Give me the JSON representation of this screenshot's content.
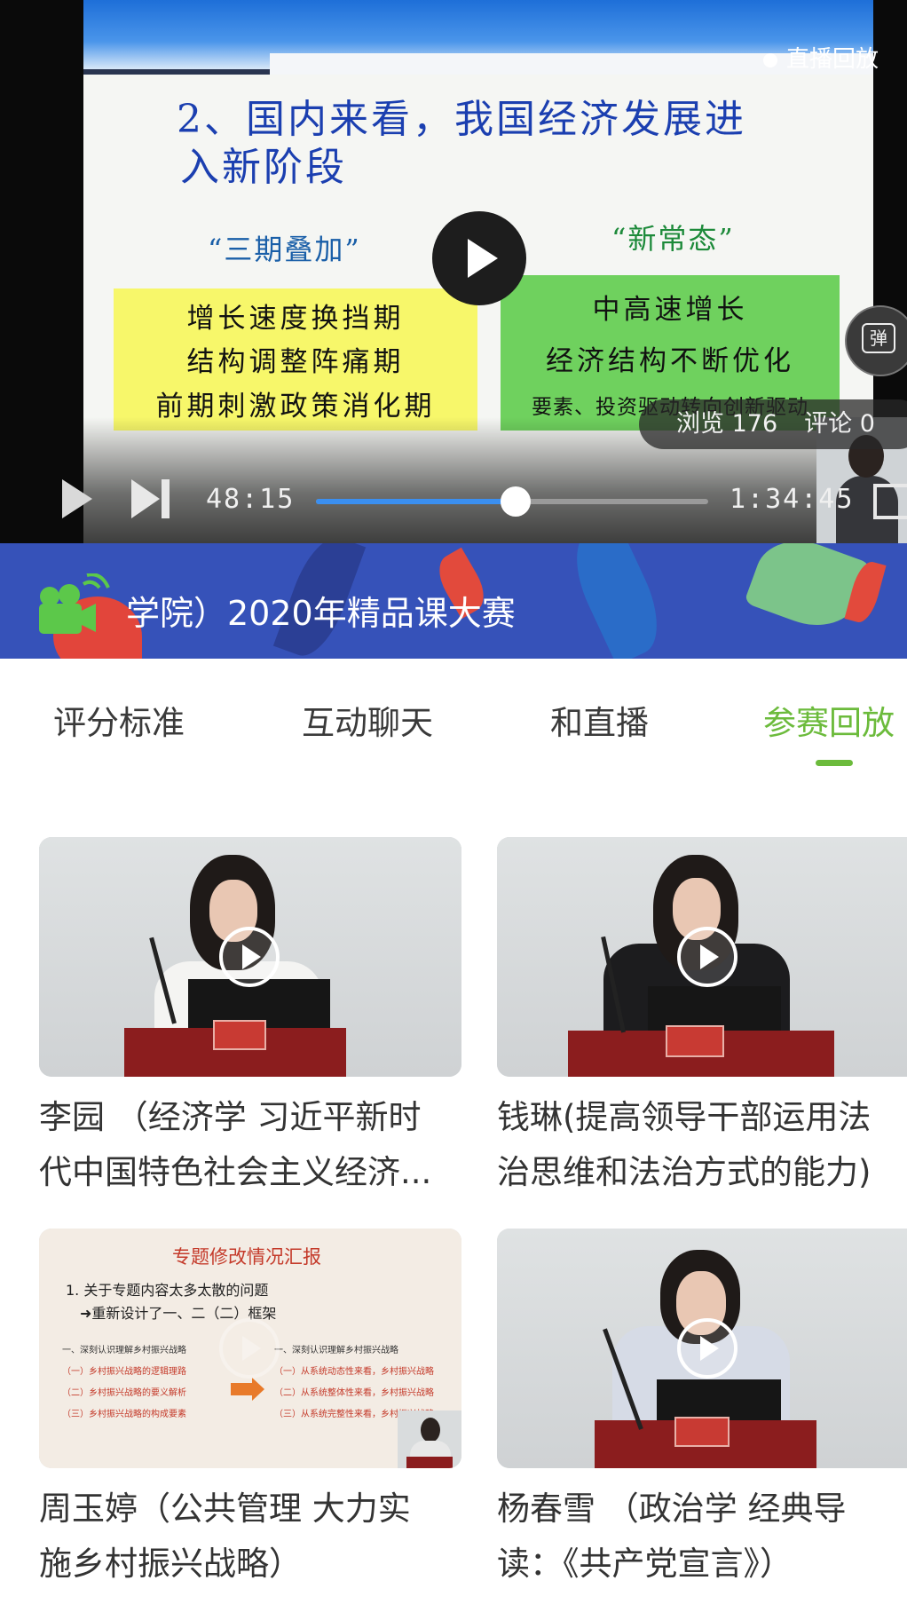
{
  "player": {
    "slide_title_line1": "2、国内来看，我国经济发展进",
    "slide_title_line2": "入新阶段",
    "left_heading": "“三期叠加”",
    "right_heading": "“新常态”",
    "left_items": [
      "增长速度换挡期",
      "结构调整阵痛期",
      "前期刺激政策消化期"
    ],
    "right_items": [
      "中高速增长",
      "经济结构不断优化",
      "要素、投资驱动转向创新驱动"
    ],
    "live_tag": "直播回放",
    "danmu_label": "弹",
    "views": "浏览 176",
    "comments": "评论 0",
    "current_time": "48:15",
    "total_time": "1:34:45",
    "progress_fraction": 0.51
  },
  "banner": {
    "title": "学院）2020年精品课大赛"
  },
  "tabs": [
    {
      "label": "评分标准",
      "active": false
    },
    {
      "label": "互动聊天",
      "active": false
    },
    {
      "label": "和直播",
      "active": false
    },
    {
      "label": "参赛回放",
      "active": true
    }
  ],
  "videos": [
    {
      "title_line1": "李园 （经济学 习近平新时",
      "title_line2": "代中国特色社会主义经济..."
    },
    {
      "title_line1": "钱琳(提高领导干部运用法",
      "title_line2": "治思维和法治方式的能力)"
    },
    {
      "title_line1": "周玉婷（公共管理 大力实",
      "title_line2": "施乡村振兴战略）"
    },
    {
      "title_line1": "杨春雪 （政治学 经典导",
      "title_line2": "读：《共产党宣言》）"
    }
  ],
  "slide_thumb": {
    "heading": "专题修改情况汇报",
    "line1": "1. 关于专题内容太多太散的问题",
    "line2": "➜重新设计了一、二（二）框架",
    "left_col": [
      "一、深刻认识理解乡村振兴战略",
      "（一）乡村振兴战略的逻辑理路",
      "（二）乡村振兴战略的要义解析",
      "（三）乡村振兴战略的构成要素"
    ],
    "right_col": [
      "一、深刻认识理解乡村振兴战略",
      "（一）从系统动态性来看，乡村振兴战略",
      "（二）从系统整体性来看，乡村振兴战略",
      "（三）从系统完整性来看，乡村振兴战略"
    ]
  },
  "colors": {
    "accent_green": "#6cbb3c",
    "progress_blue": "#3b8ff0",
    "banner_blue": "#3652b9"
  }
}
